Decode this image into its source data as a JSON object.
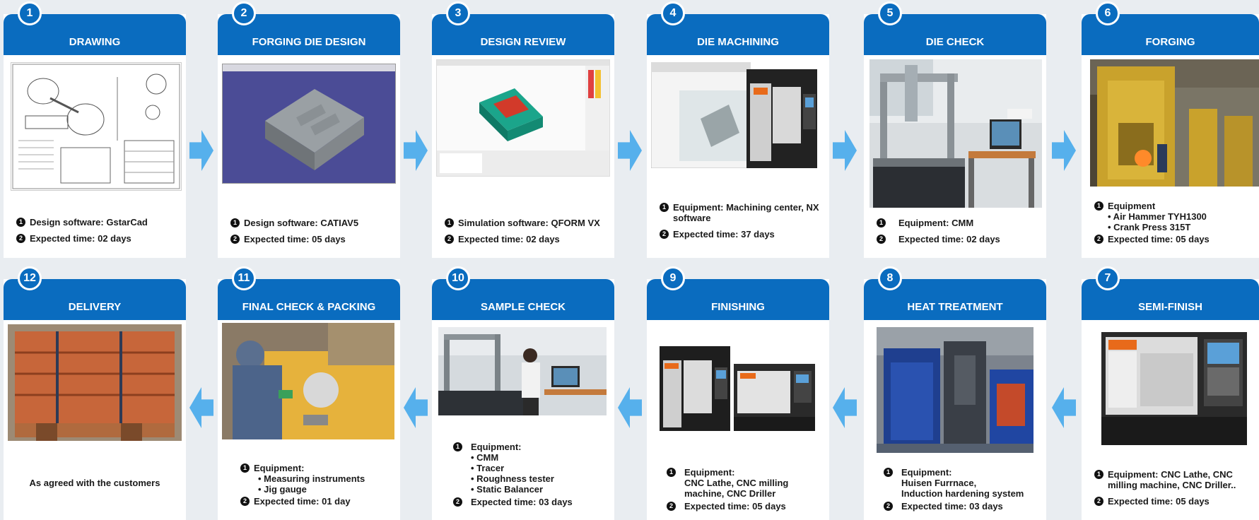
{
  "steps": [
    {
      "num": "1",
      "title": "DRAWING",
      "lines": [
        {
          "bullet": "1",
          "text": "Design software: GstarCad"
        },
        {
          "bullet": "2",
          "text": "Expected time: 02 days"
        }
      ]
    },
    {
      "num": "2",
      "title": "FORGING DIE DESIGN",
      "lines": [
        {
          "bullet": "1",
          "text": "Design software: CATIAV5"
        },
        {
          "bullet": "2",
          "text": "Expected time: 05 days"
        }
      ]
    },
    {
      "num": "3",
      "title": "DESIGN REVIEW",
      "lines": [
        {
          "bullet": "1",
          "text": "Simulation software: QFORM VX"
        },
        {
          "bullet": "2",
          "text": "Expected time: 02 days"
        }
      ]
    },
    {
      "num": "4",
      "title": "DIE MACHINING",
      "lines": [
        {
          "bullet": "1",
          "text": "Equipment: Machining center, NX software"
        },
        {
          "bullet": "2",
          "text": "Expected time: 37 days"
        }
      ]
    },
    {
      "num": "5",
      "title": "DIE CHECK",
      "lines": [
        {
          "bullet": "1",
          "text": "Equipment: CMM"
        },
        {
          "bullet": "2",
          "text": "Expected time: 02 days"
        }
      ]
    },
    {
      "num": "6",
      "title": "FORGING",
      "lines": [
        {
          "bullet": "1",
          "text": "Equipment",
          "sub": [
            "• Air Hammer TYH1300",
            "• Crank Press  315T"
          ]
        },
        {
          "bullet": "2",
          "text": "Expected time:  05 days"
        }
      ]
    },
    {
      "num": "7",
      "title": "SEMI-FINISH",
      "lines": [
        {
          "bullet": "1",
          "text": "Equipment: CNC Lathe, CNC milling machine, CNC Driller.."
        },
        {
          "bullet": "2",
          "text": "Expected time:  05 days"
        }
      ]
    },
    {
      "num": "8",
      "title": "HEAT TREATMENT",
      "lines": [
        {
          "bullet": "1",
          "text": "Equipment:",
          "sub": [
            "Huisen Furrnace,",
            "Induction hardening system"
          ]
        },
        {
          "bullet": "2",
          "text": "Expected time:  03 days"
        }
      ]
    },
    {
      "num": "9",
      "title": "FINISHING",
      "lines": [
        {
          "bullet": "1",
          "text": "Equipment:",
          "sub": [
            "CNC Lathe, CNC milling",
            "machine, CNC Driller"
          ]
        },
        {
          "bullet": "2",
          "text": "Expected time:  05 days"
        }
      ]
    },
    {
      "num": "10",
      "title": "SAMPLE CHECK",
      "lines": [
        {
          "bullet": "1",
          "text": "Equipment:",
          "sub": [
            "• CMM",
            "• Tracer",
            "• Roughness tester",
            "• Static Balancer"
          ]
        },
        {
          "bullet": "2",
          "text": "Expected time:  03 days"
        }
      ]
    },
    {
      "num": "11",
      "title": "FINAL CHECK & PACKING",
      "lines": [
        {
          "bullet": "1",
          "text": "Equipment:",
          "sub": [
            "• Measuring instruments",
            "• Jig gauge"
          ]
        },
        {
          "bullet": "2",
          "text": "Expected time: 01 day"
        }
      ]
    },
    {
      "num": "12",
      "title": "DELIVERY",
      "note": "As agreed with the customers"
    }
  ],
  "colors": {
    "header": "#0a6cbf",
    "arrow": "#56b0ec",
    "background": "#e9edf1"
  }
}
